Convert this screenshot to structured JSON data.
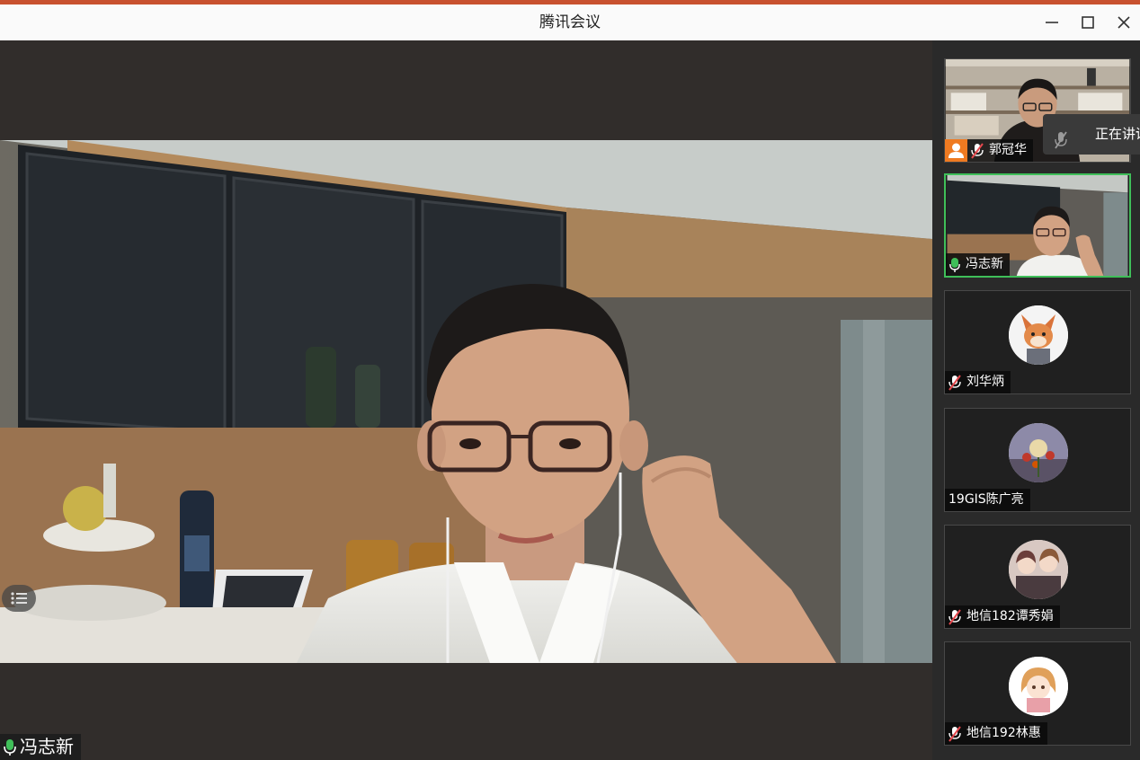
{
  "window": {
    "title": "腾讯会议",
    "controls": {
      "minimize": "minimize",
      "maximize": "maximize",
      "close": "close"
    }
  },
  "main_video": {
    "speaker_name": "冯志新",
    "mic_state": "on"
  },
  "participants": [
    {
      "name": "郭冠华",
      "mic_state": "muted",
      "role": "host",
      "has_video": true
    },
    {
      "name": "冯志新",
      "mic_state": "on",
      "active": true,
      "has_video": true
    },
    {
      "name": "刘华炳",
      "mic_state": "muted",
      "has_video": false
    },
    {
      "name": "19GIS陈广亮",
      "mic_state": "none",
      "has_video": false
    },
    {
      "name": "地信182谭秀娟",
      "mic_state": "muted",
      "has_video": false
    },
    {
      "name": "地信192林惠",
      "mic_state": "muted",
      "has_video": false
    }
  ],
  "speaking_popup": {
    "text": "正在讲话"
  },
  "colors": {
    "accent_green": "#3fbf59",
    "host_orange": "#ef7a21",
    "muted_red": "#e5484d"
  }
}
